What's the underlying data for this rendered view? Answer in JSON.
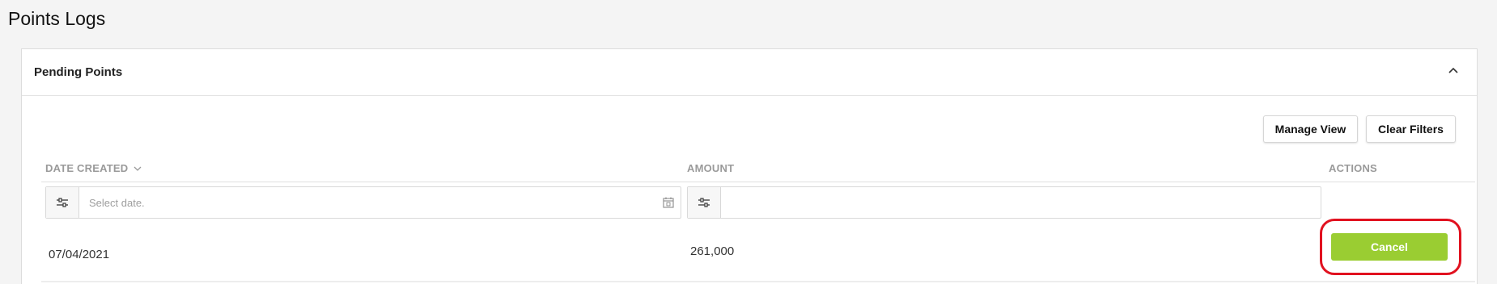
{
  "page": {
    "title": "Points Logs"
  },
  "panel": {
    "title": "Pending Points",
    "collapse_icon": "chevron-up-icon"
  },
  "toolbar": {
    "manage_view_label": "Manage View",
    "clear_filters_label": "Clear Filters"
  },
  "table": {
    "columns": [
      {
        "label": "DATE CREATED",
        "sort_icon": "chevron-down-icon"
      },
      {
        "label": "AMOUNT"
      },
      {
        "label": "ACTIONS"
      }
    ],
    "filters": {
      "date": {
        "placeholder": "Select date.",
        "value": "",
        "icon": "calendar-icon",
        "button_icon": "sliders-icon"
      },
      "amount": {
        "placeholder": "",
        "value": "",
        "button_icon": "sliders-icon"
      }
    },
    "rows": [
      {
        "date_created": "07/04/2021",
        "amount": "261,000",
        "action_label": "Cancel"
      }
    ]
  },
  "colors": {
    "accent_green": "#9acd32",
    "highlight_red": "#e1111f"
  }
}
